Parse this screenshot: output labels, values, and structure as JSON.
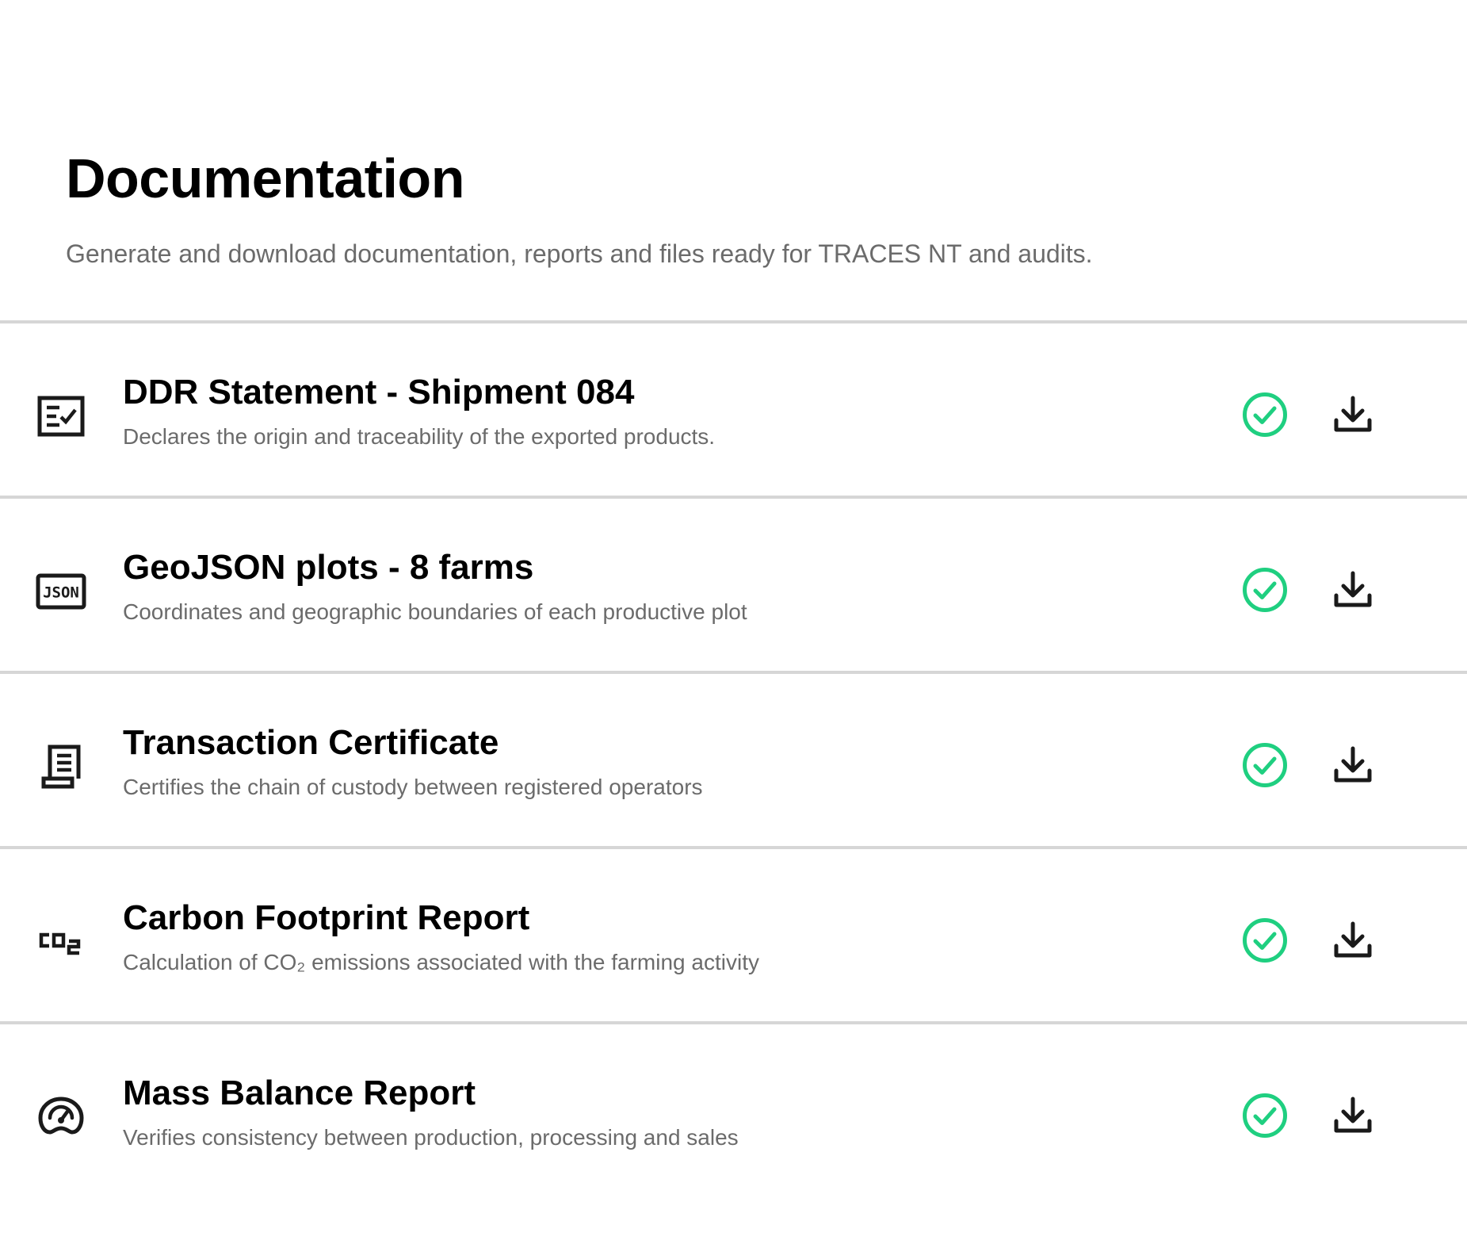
{
  "header": {
    "title": "Documentation",
    "subtitle": "Generate and download documentation, reports and files ready for TRACES NT and audits."
  },
  "colors": {
    "status_ok": "#1fcf80",
    "text_primary": "#000000",
    "text_secondary": "#6b6b6b",
    "divider": "#d6d6d6"
  },
  "documents": [
    {
      "icon": "checklist-form-icon",
      "title": "DDR Statement - Shipment 084",
      "description": "Declares the origin and traceability of the exported products.",
      "status": "check-circle-icon",
      "action": "download-icon"
    },
    {
      "icon": "json-file-icon",
      "title": "GeoJSON plots - 8 farms",
      "description": "Coordinates and geographic boundaries of each productive plot",
      "status": "check-circle-icon",
      "action": "download-icon"
    },
    {
      "icon": "receipt-scroll-icon",
      "title": "Transaction Certificate",
      "description": "Certifies the chain of custody between registered operators",
      "status": "check-circle-icon",
      "action": "download-icon"
    },
    {
      "icon": "co2-icon",
      "title": "Carbon Footprint Report",
      "description": "Calculation of CO₂ emissions associated with the farming activity",
      "status": "check-circle-icon",
      "action": "download-icon"
    },
    {
      "icon": "gauge-icon",
      "title": "Mass Balance Report",
      "description": "Verifies consistency between production, processing and sales",
      "status": "check-circle-icon",
      "action": "download-icon"
    }
  ]
}
